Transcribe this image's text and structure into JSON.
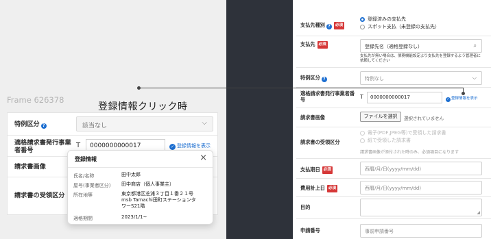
{
  "left": {
    "frame_label": "Frame 626378",
    "heading": "登録情報クリック時",
    "rows": {
      "special_label": "特例区分",
      "special_value": "該当なし",
      "invoice_label": "適格請求書発行事業者番号",
      "t_prefix": "T",
      "invoice_value": "0000000000017",
      "view_link": "登録情報を表示",
      "image_label": "請求書画像",
      "receipt_label": "請求書の受領区分"
    },
    "popup": {
      "title": "登録情報",
      "close": "×",
      "fields": [
        {
          "k": "氏名/名称",
          "v": "田中太郎"
        },
        {
          "k": "屋号(事業者区分)",
          "v": "田中商店（個人事業主）"
        },
        {
          "k": "所在地等",
          "v1": "東京都港区芝浦３丁目１番２１号",
          "v2": "msb Tamachi田町ステーションタ",
          "v3": "ワーS21階"
        },
        {
          "k": "適格期間",
          "v": "2023/1/1~"
        }
      ]
    }
  },
  "right": {
    "payee_type": {
      "label": "支払先種別",
      "req": "必須",
      "opt1": "登録済みの支払先",
      "opt2": "スポット支払（未登録の支払先）"
    },
    "payee": {
      "label": "支払先",
      "req": "必須",
      "value": "登録先名（適格登録なし）",
      "note": "支払先が無い場合は、債務機能設定より支払先を登録するよう管理者に依頼してください"
    },
    "special": {
      "label": "特例区分",
      "value": "特例なし"
    },
    "invoice": {
      "label": "適格請求書発行事業者番号",
      "t_prefix": "T",
      "value": "0000000000017",
      "link": "登録情報を表示"
    },
    "image": {
      "label": "請求書画像",
      "button": "ファイルを選択",
      "status": "選択されていません"
    },
    "receipt": {
      "label": "請求書の受領区分",
      "opt1": "電子(PDF,JPEG等)で受領した請求書",
      "opt2": "紙で受領した請求書",
      "hint": "請求書画像が添付された時のみ、必須項目になります"
    },
    "pay_date": {
      "label": "支払期日",
      "req": "必須",
      "placeholder": "西暦/月/日(yyyy/mm/dd)"
    },
    "expense_date": {
      "label": "費用計上日",
      "req": "必須",
      "placeholder": "西暦/月/日(yyyy/mm/dd)"
    },
    "purpose": {
      "label": "目的"
    },
    "app_no": {
      "label": "申請番号",
      "placeholder": "事前申請番号"
    }
  }
}
